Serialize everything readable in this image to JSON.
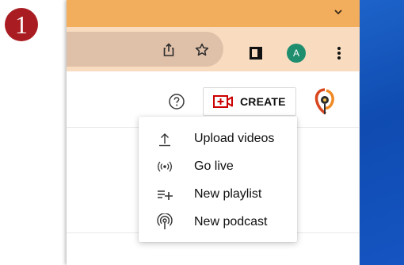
{
  "step_badge": "1",
  "browser": {
    "avatar_letter": "A",
    "icons": [
      "chevron-down-icon",
      "share-icon",
      "star-icon",
      "side-panel-icon",
      "more-vert-icon"
    ]
  },
  "header": {
    "create_label": "CREATE",
    "icons": [
      "help-icon",
      "create-video-icon",
      "channel-logo"
    ]
  },
  "create_menu": {
    "items": [
      {
        "label": "Upload videos",
        "icon": "upload-icon"
      },
      {
        "label": "Go live",
        "icon": "live-icon"
      },
      {
        "label": "New playlist",
        "icon": "playlist-add-icon"
      },
      {
        "label": "New podcast",
        "icon": "podcast-icon"
      }
    ]
  },
  "colors": {
    "badge": "#a91d22",
    "titlebar": "#f2ae5c",
    "toolbar": "#f9dcc0",
    "omnibox": "#dfc0a9",
    "avatar": "#1e8e6e",
    "create_accent": "#cc0000",
    "desktop": "#1554c2"
  }
}
